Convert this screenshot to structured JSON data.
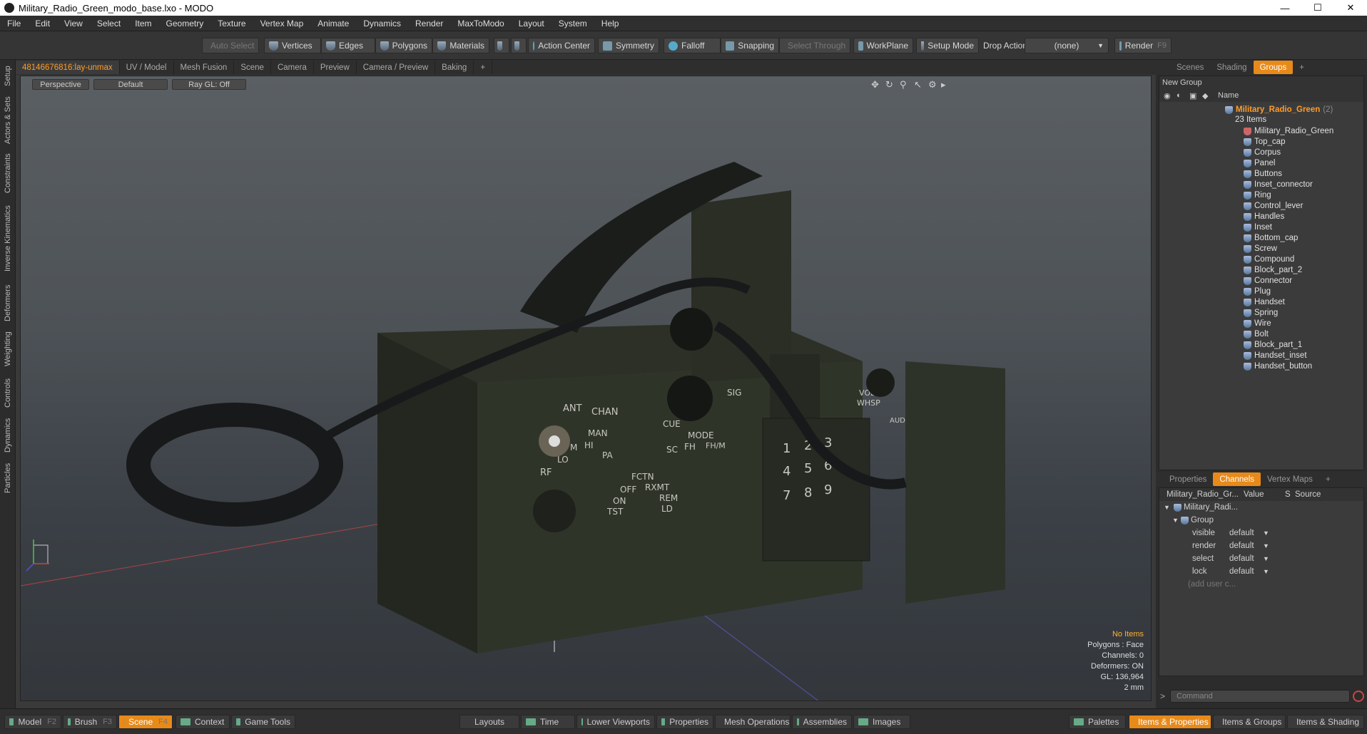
{
  "window": {
    "title": "Military_Radio_Green_modo_base.lxo - MODO"
  },
  "menu": [
    "File",
    "Edit",
    "View",
    "Select",
    "Item",
    "Geometry",
    "Texture",
    "Vertex Map",
    "Animate",
    "Dynamics",
    "Render",
    "MaxToModo",
    "Layout",
    "System",
    "Help"
  ],
  "toolbar": {
    "auto_select": "Auto Select",
    "vertices": "Vertices",
    "edges": "Edges",
    "polygons": "Polygons",
    "materials": "Materials",
    "action_center": "Action Center",
    "symmetry": "Symmetry",
    "falloff": "Falloff",
    "snapping": "Snapping",
    "select_through": "Select Through",
    "workplane": "WorkPlane",
    "setup_mode": "Setup Mode",
    "drop_action": "Drop Action",
    "drop_value": "(none)",
    "render": "Render",
    "render_key": "F9"
  },
  "left_tabs": [
    "Setup",
    "Actors & Sets",
    "Constraints",
    "Inverse Kinematics",
    "Deformers",
    "Weighting",
    "Controls",
    "Dynamics",
    "Particles"
  ],
  "viewport_tabs": [
    "48146676816:lay-unmax",
    "UV / Model",
    "Mesh Fusion",
    "Scene",
    "Camera",
    "Preview",
    "Camera / Preview",
    "Baking",
    "+"
  ],
  "viewport": {
    "view": "Perspective",
    "shading": "Default",
    "raygl": "Ray GL: Off",
    "info": {
      "no_items": "No Items",
      "polygons": "Polygons : Face",
      "channels": "Channels: 0",
      "deformers": "Deformers: ON",
      "gl": "GL: 136,964",
      "scale": "2 mm"
    }
  },
  "scene_tabs": [
    "Scenes",
    "Shading",
    "Groups",
    "+"
  ],
  "groups": {
    "new_group": "New Group",
    "name_header": "Name",
    "root": "Military_Radio_Green",
    "root_count": "(2)",
    "items_count": "23 Items",
    "items": [
      "Military_Radio_Green",
      "Top_cap",
      "Corpus",
      "Panel",
      "Buttons",
      "Inset_connector",
      "Ring",
      "Control_lever",
      "Handles",
      "Inset",
      "Bottom_cap",
      "Screw",
      "Compound",
      "Block_part_2",
      "Connector",
      "Plug",
      "Handset",
      "Spring",
      "Wire",
      "Bolt",
      "Block_part_1",
      "Handset_inset",
      "Handset_button"
    ]
  },
  "props_tabs": [
    "Properties",
    "Channels",
    "Vertex Maps",
    "+"
  ],
  "channels": {
    "header_name": "Military_Radio_Gr...",
    "header_value": "Value",
    "header_s": "S",
    "header_source": "Source",
    "item": "Military_Radi...",
    "group": "Group",
    "rows": [
      {
        "name": "visible",
        "value": "default"
      },
      {
        "name": "render",
        "value": "default"
      },
      {
        "name": "select",
        "value": "default"
      },
      {
        "name": "lock",
        "value": "default"
      }
    ],
    "add_user": "(add user c..."
  },
  "command": {
    "placeholder": "Command"
  },
  "statusbar": {
    "model": "Model",
    "model_key": "F2",
    "brush": "Brush",
    "brush_key": "F3",
    "scene": "Scene",
    "scene_key": "F4",
    "context": "Context",
    "game_tools": "Game Tools",
    "layouts": "Layouts",
    "time": "Time",
    "lower_viewports": "Lower Viewports",
    "properties": "Properties",
    "mesh_operations": "Mesh Operations",
    "assemblies": "Assemblies",
    "images": "Images",
    "palettes": "Palettes",
    "items_properties": "Items & Properties",
    "items_groups": "Items & Groups",
    "items_shading": "Items & Shading"
  },
  "radio_labels": {
    "ant": "ANT",
    "chan": "CHAN",
    "sig": "SIG",
    "vol": "VOL",
    "whsp": "WHSP",
    "man": "MAN",
    "cue": "CUE",
    "mode": "MODE",
    "sc": "SC",
    "fh": "FH",
    "fhm": "FH/M",
    "hi": "HI",
    "m": "M",
    "pa": "PA",
    "lo": "LO",
    "rf": "RF",
    "fctn": "FCTN",
    "rxmt": "RXMT",
    "rem": "REM",
    "ld": "LD",
    "off": "OFF",
    "on": "ON",
    "tst": "TST",
    "aud": "AUD"
  }
}
